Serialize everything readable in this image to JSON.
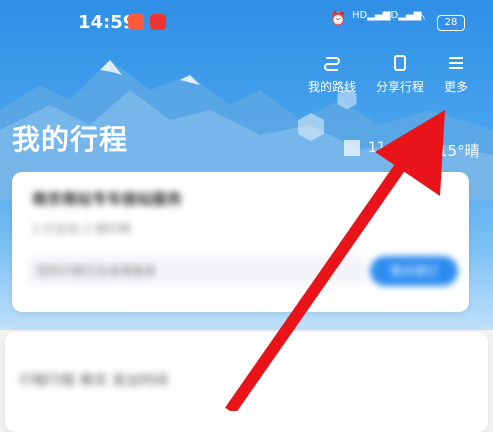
{
  "status_bar": {
    "time": "14:59",
    "signal_1": "HD",
    "signal_2": "HD",
    "battery": "28"
  },
  "header": {
    "actions": [
      {
        "label": "我的路线",
        "icon": "route-icon"
      },
      {
        "label": "分享行程",
        "icon": "share-icon"
      },
      {
        "label": "更多",
        "icon": "menu-icon"
      }
    ],
    "title": "我的行程",
    "weather_left": "11",
    "weather_right": "15°晴"
  },
  "trip_card": {
    "title": "南京南站专车接站服务",
    "subtitle": "1·行业包  2·预约明",
    "note": "您的行程已生成请查收",
    "button": "再次预订"
  },
  "next_card": {
    "text": "行程行程  南京  发出时间"
  },
  "colors": {
    "header_blue": "#2f8fe6",
    "accent_blue": "#2d8cf0",
    "arrow_red": "#e8141a"
  }
}
